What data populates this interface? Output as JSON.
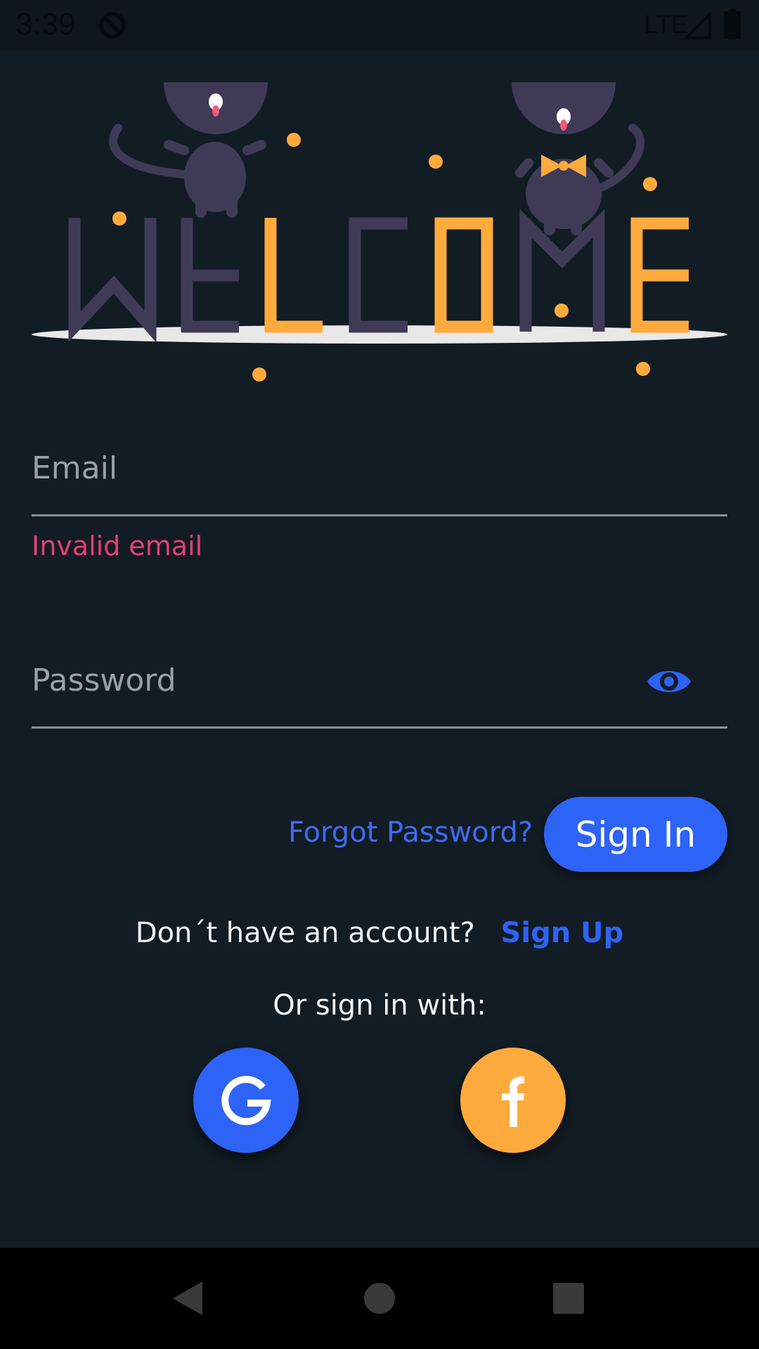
{
  "status_bar": {
    "time": "3:39",
    "network": "LTE",
    "icons": [
      "sync-icon",
      "signal-icon",
      "battery-icon"
    ]
  },
  "hero": {
    "headline": "WELCOME",
    "colors": {
      "dark_letter": "#3f3b56",
      "accent_letter": "#ffaa3c",
      "floor": "#e8e8e8"
    }
  },
  "form": {
    "email": {
      "placeholder": "Email",
      "value": ""
    },
    "email_error": "Invalid email",
    "password": {
      "placeholder": "Password",
      "value": ""
    },
    "password_toggle_icon": "eye-icon",
    "forgot_password": "Forgot Password?",
    "sign_in": "Sign In"
  },
  "signup": {
    "prompt": "Don´t have an account?",
    "link": "Sign Up"
  },
  "social": {
    "label": "Or sign in with:",
    "providers": [
      {
        "icon": "google-icon",
        "color": "#2e63f8"
      },
      {
        "icon": "facebook-icon",
        "color": "#ffaa3c"
      }
    ]
  },
  "nav": {
    "icons": [
      "back-icon",
      "home-icon",
      "recents-icon"
    ]
  },
  "colors": {
    "background": "#121c24",
    "primary": "#2e63f8",
    "accent": "#ffaa3c",
    "error": "#e63f76",
    "text": "#f2f4f6",
    "placeholder": "#9aa1a7"
  }
}
